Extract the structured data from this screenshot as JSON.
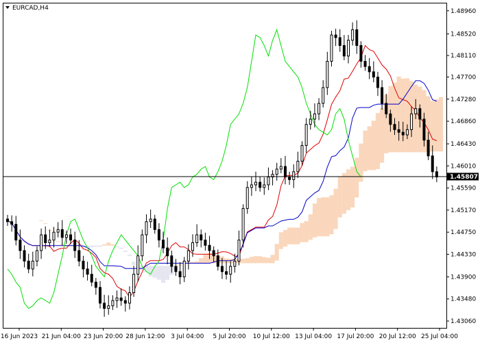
{
  "symbol_label": "EURCAD,H4",
  "colors": {
    "candle": "#000000",
    "tenkan": "#e00000",
    "kijun": "#0000c8",
    "chikou": "#00e000",
    "cloud": "#f5a76b",
    "cloud_alt": "#c8c8e0",
    "price_line": "#000000",
    "price_box_bg": "#000000",
    "price_box_text": "#ffffff"
  },
  "chart_data": {
    "type": "candlestick",
    "title": "EURCAD,H4",
    "ylim": [
      1.4306,
      1.4897
    ],
    "y_ticks": [
      "1.48960",
      "1.48520",
      "1.48110",
      "1.47700",
      "1.47280",
      "1.46860",
      "1.46430",
      "1.46010",
      "1.45590",
      "1.45170",
      "1.44750",
      "1.44330",
      "1.43900",
      "1.43480",
      "1.43060"
    ],
    "x_ticks": [
      "16 Jun 2023",
      "21 Jun 04:00",
      "23 Jun 20:00",
      "28 Jun 12:00",
      "3 Jul 04:00",
      "5 Jul 20:00",
      "10 Jul 12:00",
      "13 Jul 04:00",
      "17 Jul 20:00",
      "20 Jul 12:00",
      "25 Jul 04:00"
    ],
    "current_price": "1.45807",
    "current_price_value": 1.45807,
    "closes": [
      1.4495,
      1.449,
      1.446,
      1.444,
      1.442,
      1.4405,
      1.442,
      1.444,
      1.447,
      1.4455,
      1.446,
      1.4475,
      1.448,
      1.4465,
      1.447,
      1.446,
      1.444,
      1.442,
      1.4405,
      1.4395,
      1.438,
      1.437,
      1.434,
      1.433,
      1.4335,
      1.4345,
      1.435,
      1.4345,
      1.434,
      1.436,
      1.4395,
      1.443,
      1.447,
      1.4495,
      1.45,
      1.448,
      1.446,
      1.4445,
      1.443,
      1.441,
      1.44,
      1.439,
      1.442,
      1.444,
      1.4455,
      1.447,
      1.446,
      1.445,
      1.444,
      1.443,
      1.441,
      1.44,
      1.4395,
      1.441,
      1.442,
      1.446,
      1.452,
      1.456,
      1.4565,
      1.457,
      1.456,
      1.4565,
      1.458,
      1.4585,
      1.4595,
      1.46,
      1.458,
      1.4575,
      1.459,
      1.461,
      1.464,
      1.468,
      1.469,
      1.47,
      1.472,
      1.475,
      1.48,
      1.485,
      1.4845,
      1.483,
      1.481,
      1.484,
      1.486,
      1.483,
      1.48,
      1.479,
      1.478,
      1.477,
      1.475,
      1.472,
      1.47,
      1.468,
      1.467,
      1.4665,
      1.466,
      1.467,
      1.47,
      1.471,
      1.469,
      1.465,
      1.462,
      1.459,
      1.458
    ]
  }
}
